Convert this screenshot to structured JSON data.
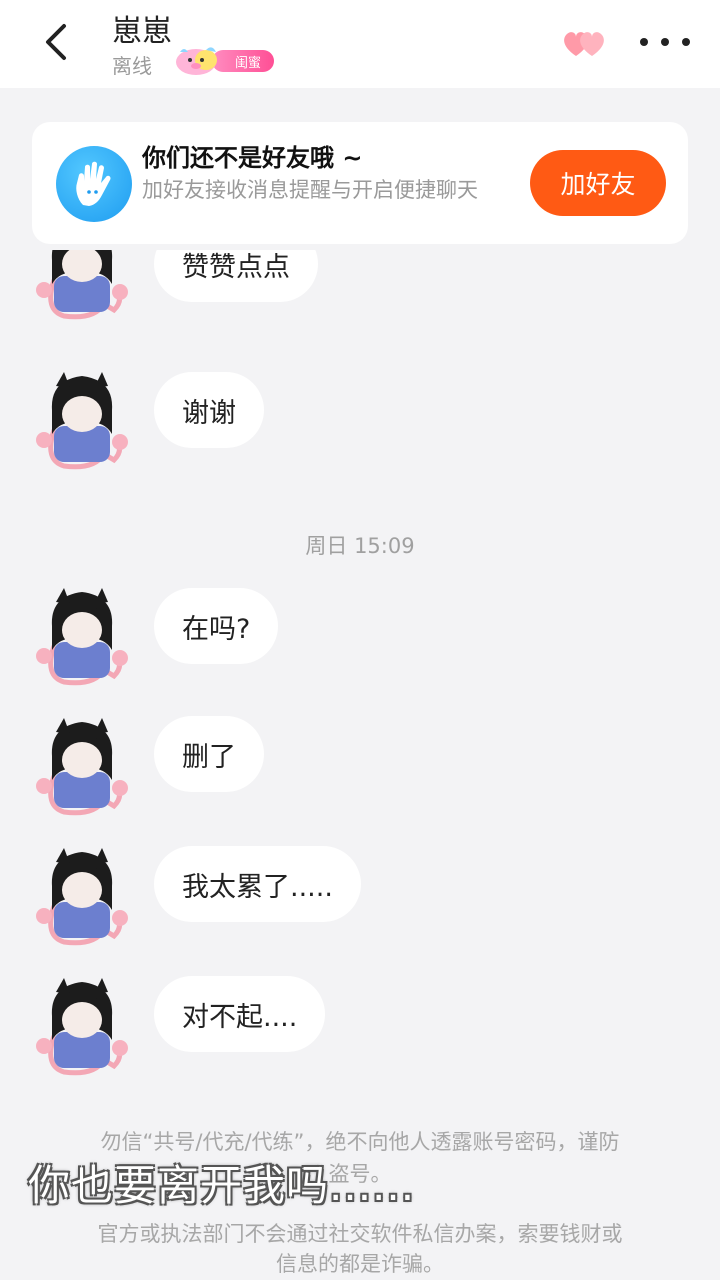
{
  "header": {
    "title": "崽崽",
    "status": "离线",
    "badge_label": "闺蜜"
  },
  "banner": {
    "title": "你们还不是好友哦 ~",
    "subtitle": "加好友接收消息提醒与开启便捷聊天",
    "add_button": "加好友"
  },
  "messages": [
    {
      "text": "赞赞点点"
    },
    {
      "text": "谢谢"
    },
    {
      "text": "在吗?"
    },
    {
      "text": "删了"
    },
    {
      "text": "我太累了....."
    },
    {
      "text": "对不起...."
    }
  ],
  "timestamp": "周日 15:09",
  "warning": {
    "line1": "勿信“共号/代充/代练”，绝不向他人透露账号密码，谨防",
    "line2": "盗号。",
    "line3": "官方或执法部门不会通过社交软件私信办案，索要钱财或",
    "line4": "信息的都是诈骗。"
  },
  "video_subtitle": "你也要离开我吗......",
  "colors": {
    "accent_orange": "#ff5a14",
    "background": "#f3f3f5",
    "bubble": "#ffffff",
    "badge_pink": "#ff4f95"
  }
}
